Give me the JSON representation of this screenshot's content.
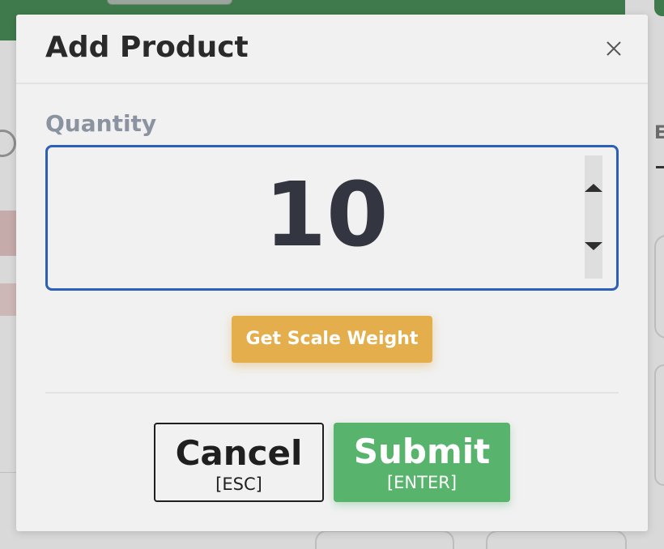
{
  "modal": {
    "title": "Add Product",
    "close_icon": "close-icon"
  },
  "quantity": {
    "label": "Quantity",
    "value": "10"
  },
  "scale_button": {
    "label": "Get Scale Weight"
  },
  "actions": {
    "cancel_label": "Cancel",
    "cancel_shortcut": "[ESC]",
    "submit_label": "Submit",
    "submit_shortcut": "[ENTER]"
  },
  "background": {
    "right_label": "E"
  },
  "colors": {
    "focus_border": "#2c5fb6",
    "scale_button": "#e3ae4b",
    "submit_button": "#58b46c",
    "topbar": "#3f7a4c"
  }
}
